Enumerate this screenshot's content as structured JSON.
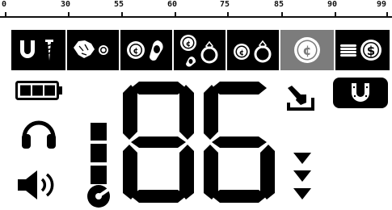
{
  "scale": {
    "ticks": [
      "0",
      "30",
      "55",
      "60",
      "75",
      "85",
      "90",
      "99"
    ]
  },
  "discrimination_bar": {
    "segments": [
      {
        "name": "iron-nail",
        "icons": [
          "magnet-icon",
          "nail-icon"
        ]
      },
      {
        "name": "foil-small-coin",
        "icons": [
          "foil-icon",
          "small-coin-icon"
        ]
      },
      {
        "name": "nickel-pulltab",
        "icons": [
          "nickel-coin-icon",
          "pulltab-icon"
        ]
      },
      {
        "name": "coin-ring-tab",
        "icons": [
          "cent-coin-icon",
          "ring-icon",
          "pulltab-small-icon"
        ]
      },
      {
        "name": "coin-ring",
        "icons": [
          "cent-coin-icon",
          "ring-icon"
        ]
      },
      {
        "name": "large-coin",
        "icons": [
          "large-cent-coin-icon"
        ],
        "selected": true
      },
      {
        "name": "silver-dollar",
        "icons": [
          "coin-stack-icon",
          "dollar-coin-icon"
        ]
      }
    ]
  },
  "display": {
    "target_id": "86",
    "battery_level": 1.0,
    "depth_level": 3,
    "mode_icon": "horseshoe-mode-icon",
    "colors": {
      "selected_segment": "#7c7c7c",
      "lcd": "#000000",
      "background": "#ffffff"
    }
  }
}
